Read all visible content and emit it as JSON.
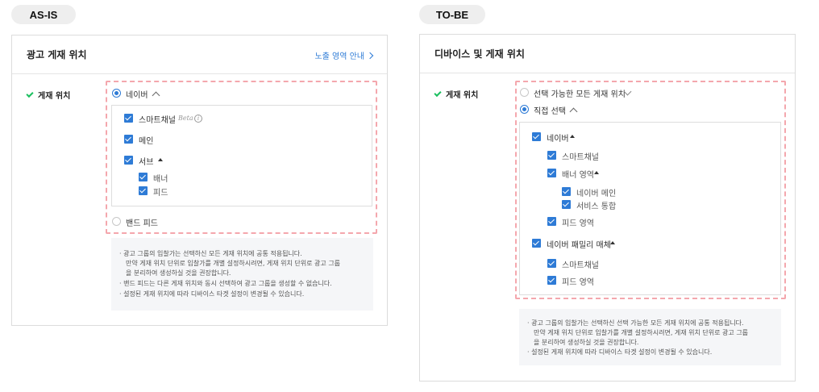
{
  "asis": {
    "tag": "AS-IS",
    "header_title": "광고 게재 위치",
    "header_link": "노출 영역 안내",
    "row_label": "게재 위치",
    "radio_naver": "네이버",
    "items": {
      "smartchannel": "스마트채널",
      "beta": "Beta",
      "main": "메인",
      "serve": "서브",
      "banner": "배너",
      "feed": "피드"
    },
    "radio_band": "밴드 피드",
    "notes": [
      "· 광고 그룹의 입찰가는 선택하신 모든 게재 위치에 공통 적용됩니다.",
      "만약 게재 위치 단위로 입찰가를 개별 설정하시려면, 게재 위치 단위로 광고 그룹",
      "을 분리하여 생성하실 것을 권장합니다.",
      "· 밴드 피드는 다른 게재 위치와 동시 선택하여 광고 그룹을 생성할 수 없습니다.",
      "· 설정된 게재 위치에 따라 디바이스 타겟 설정이 변경될 수 있습니다."
    ]
  },
  "tobe": {
    "tag": "TO-BE",
    "header_title": "디바이스 및 게재 위치",
    "row_label": "게재 위치",
    "radio_all": "선택 가능한 모든 게재 위치",
    "radio_direct": "직접 선택",
    "items": {
      "naver": "네이버",
      "smartchannel": "스마트채널",
      "banner_area": "배너 영역",
      "naver_main": "네이버 메인",
      "service_integrated": "서비스 통합",
      "feed_area": "피드 영역",
      "family_media": "네이버 패밀리 매체",
      "family_smartchannel": "스마트채널",
      "family_feed_area": "피드 영역"
    },
    "notes": [
      "· 광고 그룹의 입찰가는 선택하신 선택 가능한 모든 게재 위치에 공통 적용됩니다.",
      "만약 게재 위치 단위로 입찰가를 개별 설정하시려면, 게재 위치 단위로 광고 그룹",
      "을 분리하여 생성하실 것을 권장합니다.",
      "· 설정된 게재 위치에 따라 디바이스 타겟 설정이 변경될 수 있습니다."
    ]
  },
  "colors": {
    "accent": "#2e7bd6",
    "check_green": "#1bbf5f",
    "dashed_highlight": "#f4a7ad",
    "note_bg": "#f5f6f8"
  }
}
